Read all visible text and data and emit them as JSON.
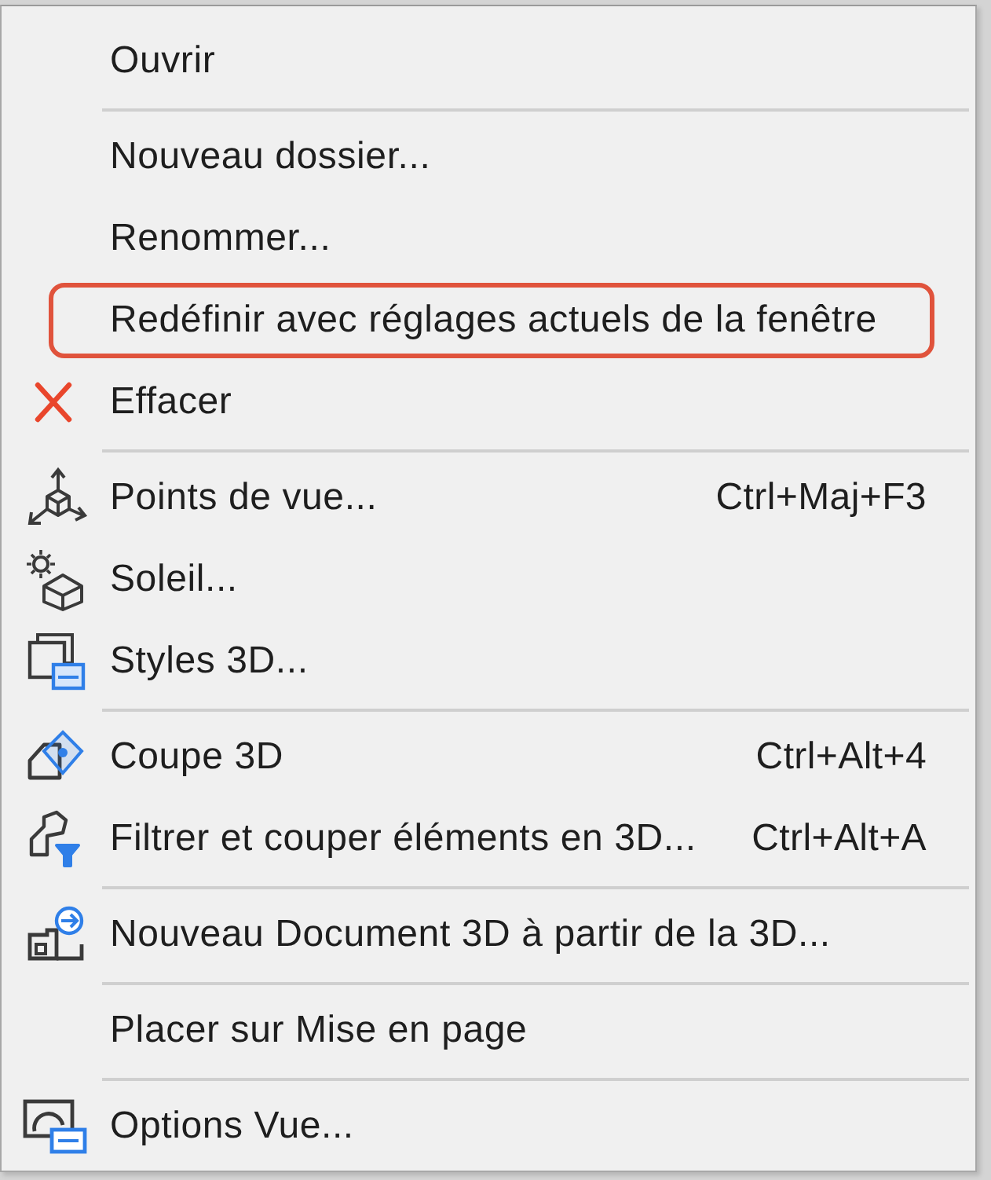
{
  "menu": {
    "groups": [
      {
        "items": [
          {
            "label": "Ouvrir",
            "highlighted": false
          }
        ]
      },
      {
        "items": [
          {
            "label": "Nouveau dossier...",
            "highlighted": false
          },
          {
            "label": "Renommer...",
            "highlighted": false
          },
          {
            "label": "Redéfinir avec réglages actuels de la fenêtre",
            "highlighted": true
          },
          {
            "label": "Effacer",
            "highlighted": false
          }
        ]
      },
      {
        "items": [
          {
            "label": "Points de vue...",
            "shortcut": "Ctrl+Maj+F3",
            "highlighted": false
          },
          {
            "label": "Soleil...",
            "highlighted": false
          },
          {
            "label": "Styles 3D...",
            "highlighted": false
          }
        ]
      },
      {
        "items": [
          {
            "label": "Coupe 3D",
            "shortcut": "Ctrl+Alt+4",
            "highlighted": false
          },
          {
            "label": "Filtrer et couper éléments en 3D...",
            "shortcut": "Ctrl+Alt+A",
            "highlighted": false
          }
        ]
      },
      {
        "items": [
          {
            "label": "Nouveau Document 3D à partir de la 3D...",
            "highlighted": false
          }
        ]
      },
      {
        "items": [
          {
            "label": "Placer sur Mise en page",
            "highlighted": false
          }
        ]
      },
      {
        "items": [
          {
            "label": "Options Vue...",
            "highlighted": false
          }
        ]
      }
    ]
  }
}
